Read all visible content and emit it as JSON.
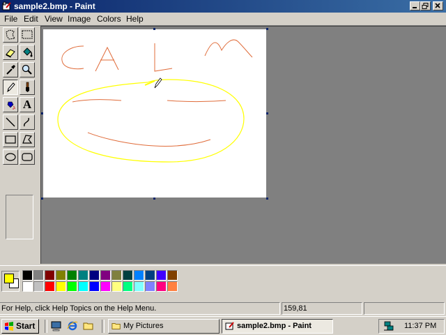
{
  "window": {
    "title": "sample2.bmp - Paint",
    "controls": {
      "minimize": "0",
      "restore": "2",
      "close": "r"
    }
  },
  "menu": [
    "File",
    "Edit",
    "View",
    "Image",
    "Colors",
    "Help"
  ],
  "tools": [
    {
      "name": "free-form-select-tool",
      "icon": "free-select-icon"
    },
    {
      "name": "select-tool",
      "icon": "rect-select-icon"
    },
    {
      "name": "eraser-tool",
      "icon": "eraser-icon"
    },
    {
      "name": "fill-tool",
      "icon": "paint-bucket-icon"
    },
    {
      "name": "pick-color-tool",
      "icon": "eyedropper-icon"
    },
    {
      "name": "magnifier-tool",
      "icon": "magnifier-icon"
    },
    {
      "name": "pencil-tool",
      "icon": "pencil-icon",
      "active": true
    },
    {
      "name": "brush-tool",
      "icon": "brush-icon"
    },
    {
      "name": "airbrush-tool",
      "icon": "airbrush-icon"
    },
    {
      "name": "text-tool",
      "icon": "text-icon",
      "label": "A"
    },
    {
      "name": "line-tool",
      "icon": "line-icon"
    },
    {
      "name": "curve-tool",
      "icon": "curve-icon"
    },
    {
      "name": "rectangle-tool",
      "icon": "rectangle-icon"
    },
    {
      "name": "polygon-tool",
      "icon": "polygon-icon"
    },
    {
      "name": "ellipse-tool",
      "icon": "ellipse-icon"
    },
    {
      "name": "rounded-rectangle-tool",
      "icon": "rounded-rect-icon"
    }
  ],
  "colors": {
    "foreground": "#ffff00",
    "background": "#ffffff",
    "palette_top": [
      "#000000",
      "#808080",
      "#800000",
      "#808000",
      "#008000",
      "#008080",
      "#000080",
      "#800080",
      "#808040",
      "#004040",
      "#0080ff",
      "#004080",
      "#4000ff",
      "#804000"
    ],
    "palette_bottom": [
      "#ffffff",
      "#c0c0c0",
      "#ff0000",
      "#ffff00",
      "#00ff00",
      "#00ffff",
      "#0000ff",
      "#ff00ff",
      "#ffff80",
      "#00ff80",
      "#80ffff",
      "#8080ff",
      "#ff0080",
      "#ff8040"
    ]
  },
  "status": {
    "help_text": "For Help, click Help Topics on the Help Menu.",
    "coordinates": "159,81",
    "size": ""
  },
  "taskbar": {
    "start_label": "Start",
    "quick_launch": [
      "desktop-icon",
      "internet-explorer-icon",
      "folder-icon"
    ],
    "tasks": [
      {
        "label": "My Pictures",
        "icon": "folder-icon",
        "active": false
      },
      {
        "label": "sample2.bmp - Paint",
        "icon": "paint-icon",
        "active": true
      }
    ],
    "clock": "11:37 PM"
  }
}
